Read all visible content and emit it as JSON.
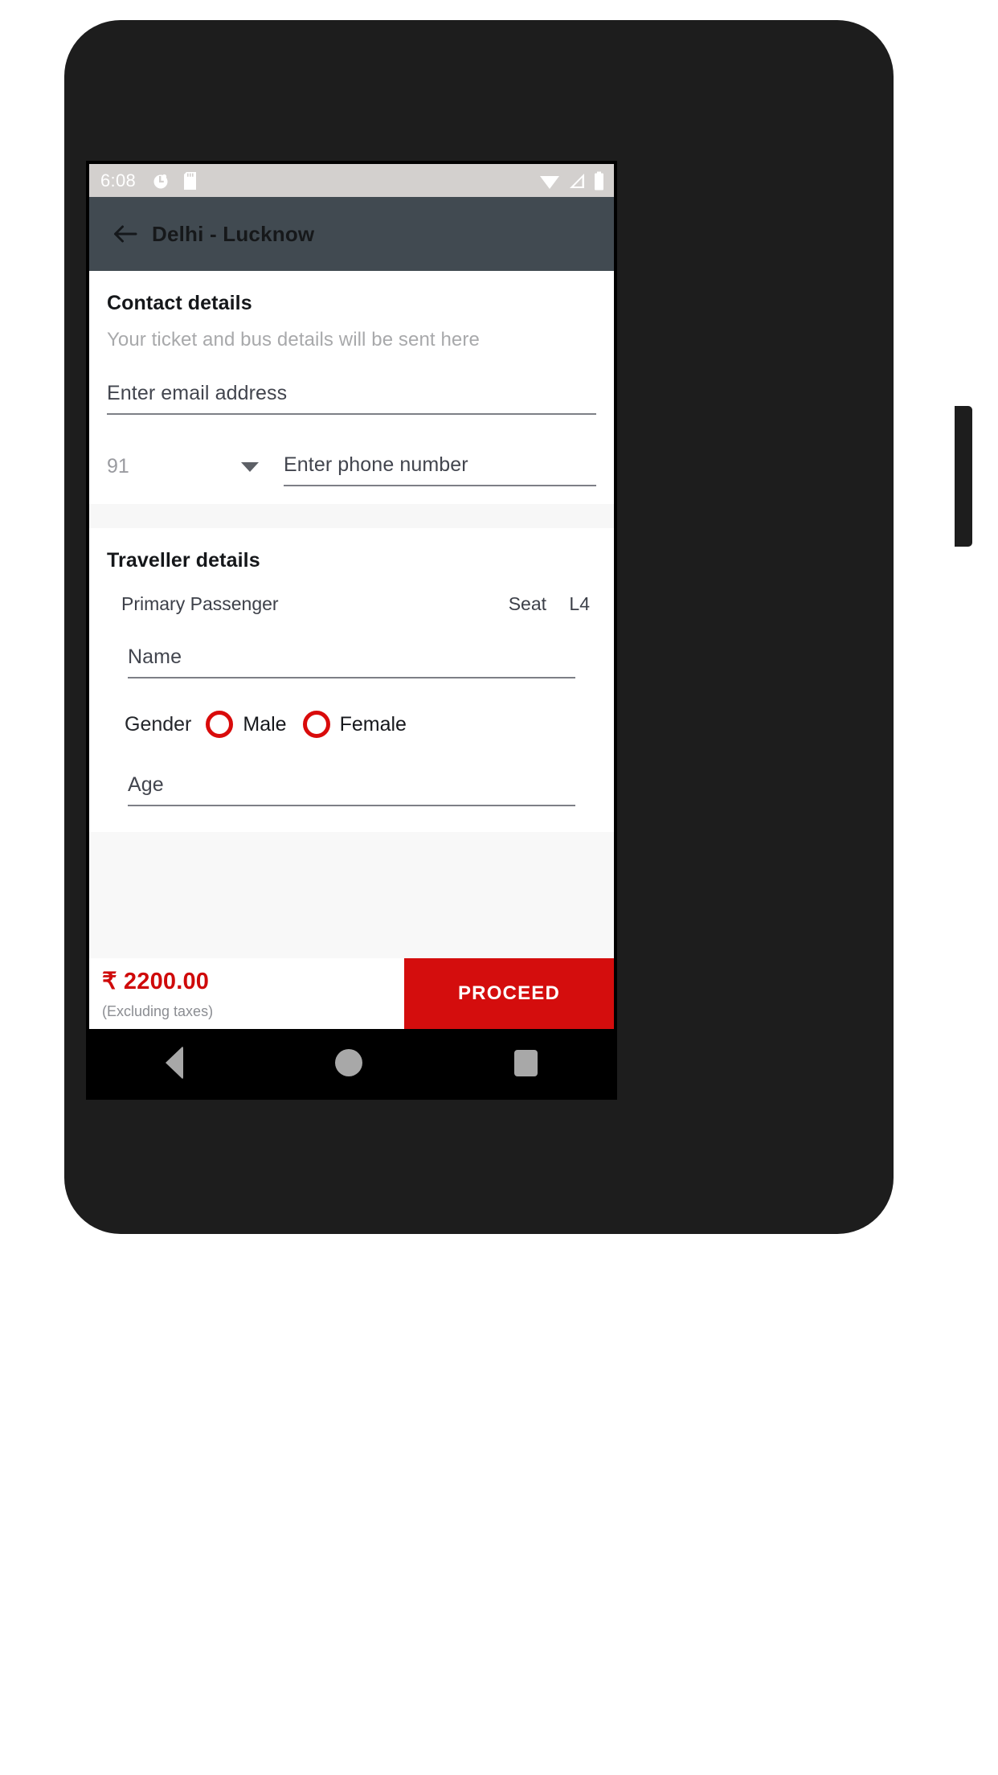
{
  "status_bar": {
    "time": "6:08",
    "left_icons": [
      "alarm-icon",
      "sd-card-icon"
    ],
    "right_icons": [
      "wifi-icon",
      "signal-icon",
      "battery-icon"
    ]
  },
  "app_bar": {
    "back_icon": "back-arrow-icon",
    "title": "Delhi - Lucknow"
  },
  "contact": {
    "title": "Contact details",
    "subtitle": "Your ticket and bus details will be sent here",
    "email_placeholder": "Enter email address",
    "country_code": "91",
    "country_code_caret": "chevron-down-icon",
    "phone_placeholder": "Enter phone number"
  },
  "traveller": {
    "title": "Traveller details",
    "passenger_label": "Primary Passenger",
    "seat_label": "Seat",
    "seat_number": "L4",
    "name_placeholder": "Name",
    "gender_label": "Gender",
    "gender_options": [
      {
        "label": "Male",
        "selected": false
      },
      {
        "label": "Female",
        "selected": false
      }
    ],
    "age_placeholder": "Age"
  },
  "bottom_bar": {
    "price": "₹ 2200.00",
    "price_note": "(Excluding taxes)",
    "proceed_label": "PROCEED"
  },
  "nav_bar": {
    "back": "nav-back-icon",
    "home": "nav-home-icon",
    "recents": "nav-recents-icon"
  },
  "colors": {
    "accent_red": "#d40d0d",
    "app_bar": "#414a51",
    "status_bar": "#d3d0ce",
    "price_red": "#cf0a0a"
  }
}
